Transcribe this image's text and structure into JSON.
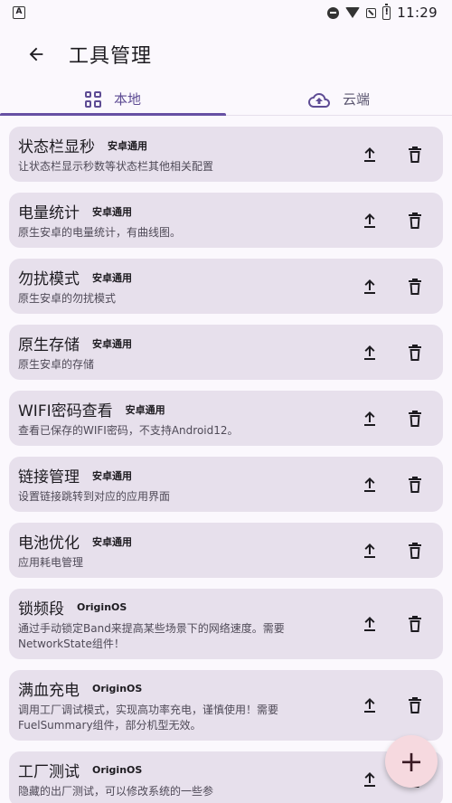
{
  "status_bar": {
    "app_badge": "A",
    "time": "11:29"
  },
  "header": {
    "title": "工具管理"
  },
  "tabs": [
    {
      "label": "本地",
      "icon": "grid-icon",
      "active": true
    },
    {
      "label": "云端",
      "icon": "cloud-upload-icon",
      "active": false
    }
  ],
  "tools": [
    {
      "title": "状态栏显秒",
      "tag": "安卓通用",
      "desc": "让状态栏显示秒数等状态栏其他相关配置"
    },
    {
      "title": "电量统计",
      "tag": "安卓通用",
      "desc": "原生安卓的电量统计，有曲线图。"
    },
    {
      "title": "勿扰模式",
      "tag": "安卓通用",
      "desc": "原生安卓的勿扰模式"
    },
    {
      "title": "原生存储",
      "tag": "安卓通用",
      "desc": "原生安卓的存储"
    },
    {
      "title": "WIFI密码查看",
      "tag": "安卓通用",
      "desc": "查看已保存的WIFI密码，不支持Android12。"
    },
    {
      "title": "链接管理",
      "tag": "安卓通用",
      "desc": "设置链接跳转到对应的应用界面"
    },
    {
      "title": "电池优化",
      "tag": "安卓通用",
      "desc": "应用耗电管理"
    },
    {
      "title": "锁频段",
      "tag": "OriginOS",
      "desc": "通过手动锁定Band来提高某些场景下的网络速度。需要NetworkState组件！"
    },
    {
      "title": "满血充电",
      "tag": "OriginOS",
      "desc": "调用工厂调试模式，实现高功率充电，谨慎使用！需要FuelSummary组件，部分机型无效。"
    },
    {
      "title": "工厂测试",
      "tag": "OriginOS",
      "desc": "隐藏的出厂测试，可以修改系统的一些参"
    }
  ],
  "fab": {
    "label": "+"
  },
  "colors": {
    "accent": "#6750a4",
    "card_bg": "#e7e0ec",
    "fab_bg": "#f6d9df"
  }
}
